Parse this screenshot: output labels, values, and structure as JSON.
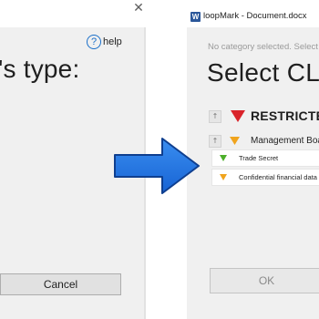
{
  "left_dialog": {
    "close_glyph": "✕",
    "help": {
      "icon": "question-icon",
      "glyph": "?",
      "label": "help"
    },
    "heading": "'s type:",
    "cancel_label": "Cancel"
  },
  "right_dialog": {
    "app_icon": "word-icon",
    "app_icon_glyph": "W",
    "window_title": "loopMark - Document.docx",
    "hint": "No category selected. Select",
    "heading": "Select CLA",
    "ok_label": "OK",
    "classifications": [
      {
        "label": "RESTRICTED",
        "icon": "red-triangle-icon",
        "color": "#d9232a",
        "sort_glyph": "↑"
      },
      {
        "label": "Management Boa",
        "icon": "orange-triangle-icon",
        "color": "#f0a41d",
        "sort_glyph": "↑"
      }
    ],
    "sub_items": [
      {
        "label": "Trade Secret",
        "icon": "green-triangle-icon",
        "color": "#4caf2a"
      },
      {
        "label": "Confidential financial data",
        "icon": "orange-triangle-icon",
        "color": "#f0a41d"
      }
    ]
  },
  "arrow": {
    "icon": "right-arrow-icon",
    "color": "#1e6fd9"
  }
}
